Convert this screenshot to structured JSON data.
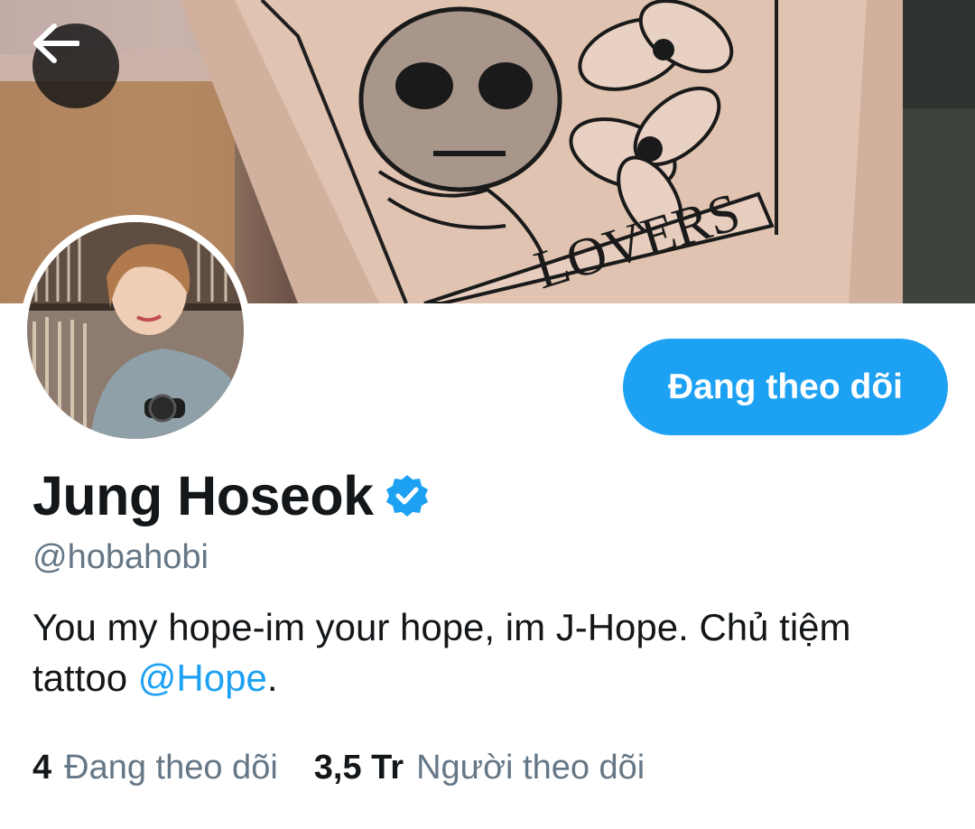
{
  "header": {
    "banner_text": "LOVERS",
    "back_icon": "arrow-left-icon"
  },
  "profile": {
    "display_name": "Jung Hoseok",
    "verified_icon": "verified-badge-icon",
    "handle": "@hobahobi",
    "follow_button_label": "Đang theo dõi",
    "bio": {
      "text_before": "You my hope-im your hope, im J-Hope. Chủ tiệm tattoo ",
      "mention": "@Hope",
      "text_after": "."
    },
    "stats": {
      "following_count": "4",
      "following_label": "Đang theo dõi",
      "followers_count": "3,5 Tr",
      "followers_label": "Người theo dõi"
    }
  },
  "colors": {
    "accent": "#1da1f2",
    "text_primary": "#14171a",
    "text_secondary": "#657786"
  }
}
